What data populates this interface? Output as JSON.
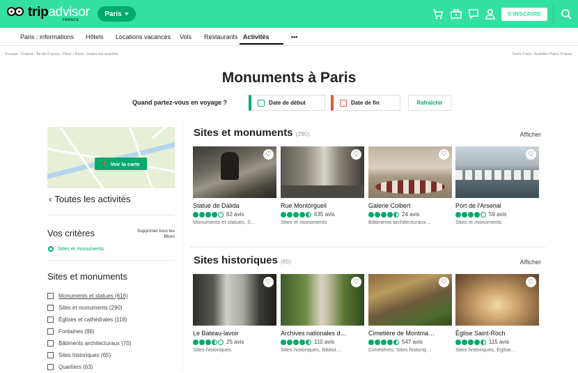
{
  "header": {
    "brand_trip": "trip",
    "brand_advisor": "advisor",
    "country": "FRANCE",
    "city_button": "Paris",
    "signin_label": "S'INSCRIRE",
    "icons": [
      "cart-icon",
      "briefcase-icon",
      "chat-icon",
      "user-icon",
      "search-icon"
    ]
  },
  "nav": {
    "items": [
      "Paris : informations",
      "Hôtels",
      "Locations vacances",
      "Vols",
      "Restaurants",
      "Activités",
      "•••"
    ],
    "active_index": 5
  },
  "breadcrumb": {
    "path": "Europe › France › Île-de-France › Paris › Paris : toutes les activités",
    "right": "Sortir Paris - Activités Paris, France"
  },
  "page": {
    "title": "Monuments à Paris",
    "when_label": "Quand partez-vous en voyage ?",
    "start_date": "Date de début",
    "end_date": "Date de fin",
    "refresh": "Rafraîchir"
  },
  "sidebar": {
    "map_button": "Voir la carte",
    "back_link": "Toutes les activités",
    "criteria_title": "Vos critères",
    "clear_filters": "Supprimer tous les filtres",
    "selected_criterion": "Sites et monuments",
    "filter_heading": "Sites et monuments",
    "filters": [
      "Monuments et statues (616)",
      "Sites et monuments (290)",
      "Églises et cathédrales (118)",
      "Fontaines (86)",
      "Bâtiments architecturaux (70)",
      "Sites historiques (65)",
      "Quartiers (63)"
    ]
  },
  "sections": [
    {
      "title": "Sites et monuments",
      "count": "(290)",
      "show_all": "Afficher",
      "cards": [
        {
          "name": "Statue de Dalida",
          "rating": 4,
          "reviews": "62 avis",
          "category": "Monuments et statues, S…"
        },
        {
          "name": "Rue Montorgueil",
          "rating": 4.5,
          "reviews": "635 avis",
          "category": "Sites et monuments"
        },
        {
          "name": "Galerie Colbert",
          "rating": 4.5,
          "reviews": "24 avis",
          "category": "Bâtiments architecturaux…"
        },
        {
          "name": "Port de l'Arsenal",
          "rating": 4,
          "reviews": "59 avis",
          "category": "Sites et monuments"
        }
      ]
    },
    {
      "title": "Sites historiques",
      "count": "(65)",
      "show_all": "Afficher",
      "cards": [
        {
          "name": "Le Bateau-lavoir",
          "rating": 3.5,
          "reviews": "25 avis",
          "category": "Sites historiques"
        },
        {
          "name": "Archives nationales d…",
          "rating": 4.5,
          "reviews": "110 avis",
          "category": "Sites historiques, Bibliot…"
        },
        {
          "name": "Cimetière de Montma…",
          "rating": 4.5,
          "reviews": "547 avis",
          "category": "Cimetières, Sites historiq…"
        },
        {
          "name": "Église Saint-Roch",
          "rating": 4.5,
          "reviews": "115 avis",
          "category": "Sites historiques, Église…"
        }
      ]
    }
  ],
  "colors": {
    "brand": "#34e0a1",
    "accent": "#00aa6c",
    "end_date_accent": "#e2583e"
  }
}
